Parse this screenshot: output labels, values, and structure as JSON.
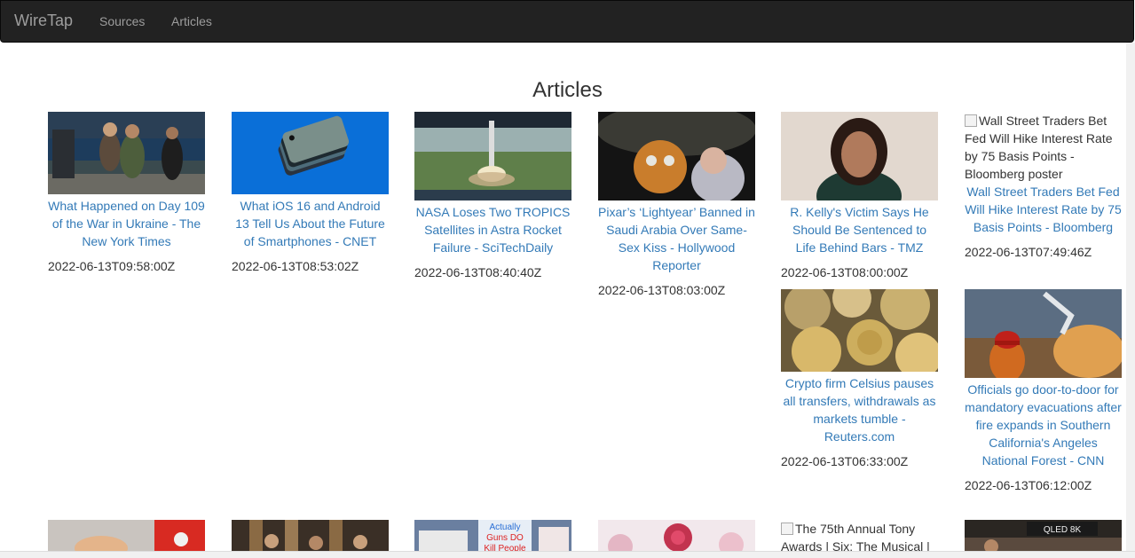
{
  "navbar": {
    "brand": "WireTap",
    "links": [
      "Sources",
      "Articles"
    ]
  },
  "page": {
    "title": "Articles"
  },
  "articles": [
    {
      "title": "What Happened on Day 109 of the War in Ukraine - The New York Times",
      "date": "2022-06-13T09:58:00Z"
    },
    {
      "title": "What iOS 16 and Android 13 Tell Us About the Future of Smartphones - CNET",
      "date": "2022-06-13T08:53:02Z"
    },
    {
      "title": "NASA Loses Two TROPICS Satellites in Astra Rocket Failure - SciTechDaily",
      "date": "2022-06-13T08:40:40Z"
    },
    {
      "title": "Pixar’s ‘Lightyear’ Banned in Saudi Arabia Over Same-Sex Kiss - Hollywood Reporter",
      "date": "2022-06-13T08:03:00Z"
    },
    {
      "title": "R. Kelly's Victim Says He Should Be Sentenced to Life Behind Bars - TMZ",
      "date": "2022-06-13T08:00:00Z"
    },
    {
      "title": "Wall Street Traders Bet Fed Will Hike Interest Rate by 75 Basis Points - Bloomberg",
      "alt": "Wall Street Traders Bet Fed Will Hike Interest Rate by 75 Basis Points - Bloomberg poster",
      "date": "2022-06-13T07:49:46Z"
    },
    {
      "title": "Crypto firm Celsius pauses all transfers, withdrawals as markets tumble - Reuters.com",
      "date": "2022-06-13T06:33:00Z"
    },
    {
      "title": "Officials go door-to-door for mandatory evacuations after fire expands in Southern California's Angeles National Forest - CNN",
      "date": "2022-06-13T06:12:00Z"
    },
    {
      "alt": "The 75th Annual Tony Awards | Six: The Musical |"
    },
    {
      "image_text": [
        "Actually",
        "Guns DO",
        "Kill People"
      ]
    },
    {
      "image_text": [
        "QLED 8K"
      ]
    }
  ],
  "colors": {
    "link": "#337ab7",
    "navbar": "#222222",
    "navtext": "#9d9d9d"
  }
}
